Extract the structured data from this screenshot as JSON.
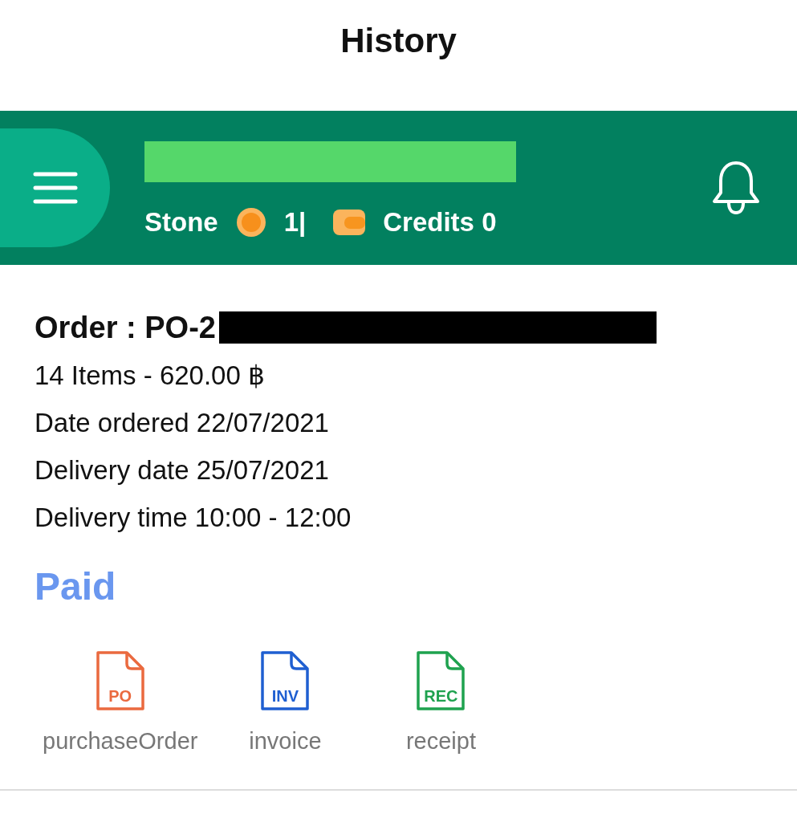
{
  "header": {
    "title": "History"
  },
  "top_bar": {
    "stone_label": "Stone",
    "stone_value": "1|",
    "credits": "Credits 0"
  },
  "order": {
    "title": "Order : PO-2",
    "lines": [
      "14 Items - 620.00 ฿",
      "Date ordered 22/07/2021",
      "Delivery date 25/07/2021",
      "Delivery time 10:00 - 12:00"
    ],
    "status": {
      "kind": "paid",
      "text": "Paid"
    }
  },
  "documents": [
    {
      "tag": "PO",
      "label": "purchaseOrder",
      "color": "#ea6a3f"
    },
    {
      "tag": "INV",
      "label": "invoice",
      "color": "#1f5fd1"
    },
    {
      "tag": "REC",
      "label": "receipt",
      "color": "#1fa24f"
    }
  ]
}
